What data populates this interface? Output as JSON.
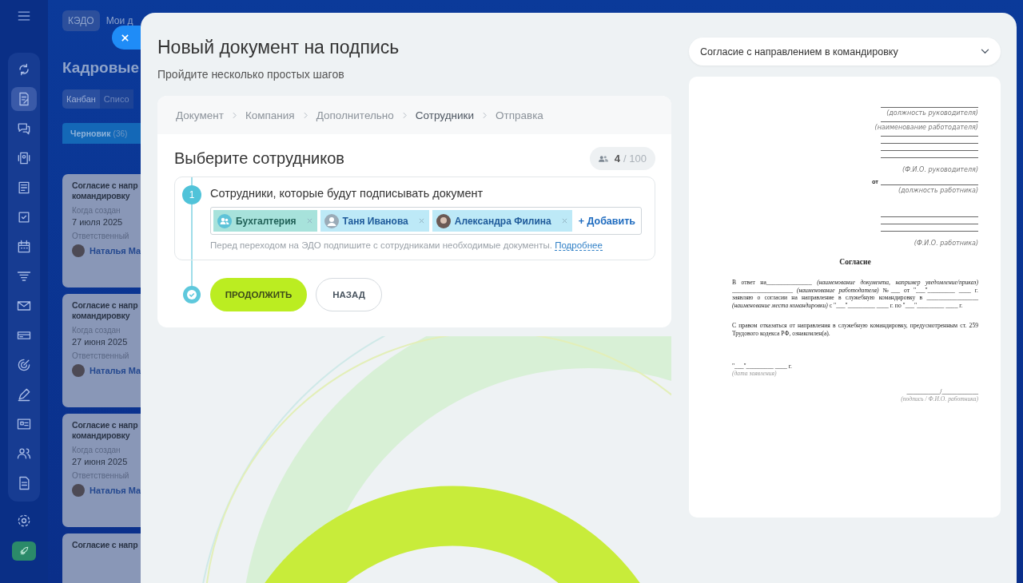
{
  "sidebar": {
    "items": [
      {
        "selected": false
      },
      {
        "selected": true
      },
      {
        "selected": false
      },
      {
        "selected": false
      },
      {
        "selected": false
      },
      {
        "selected": false
      },
      {
        "selected": false
      },
      {
        "selected": false
      },
      {
        "selected": false
      },
      {
        "selected": false
      },
      {
        "selected": false
      },
      {
        "selected": false
      },
      {
        "selected": false
      },
      {
        "selected": false
      },
      {
        "selected": false
      }
    ]
  },
  "background_page": {
    "top_tabs": [
      {
        "label": "КЭДО",
        "selected": true
      },
      {
        "label": "Мои д",
        "selected": false
      }
    ],
    "title": "Кадровые",
    "view_tabs": [
      {
        "label": "Канбан",
        "selected": true
      },
      {
        "label": "Списо",
        "selected": false
      }
    ],
    "column": {
      "name": "Черновик",
      "count": "(36)"
    },
    "cards": [
      {
        "title_lines": [
          "Согласие с напр",
          "командировку"
        ],
        "created_label": "Когда создан",
        "created": "7 июля 2025",
        "owner_label": "Ответственный",
        "owner": "Наталья Ма"
      },
      {
        "title_lines": [
          "Согласие с напр",
          "командировку"
        ],
        "created_label": "Когда создан",
        "created": "27 июня 2025",
        "owner_label": "Ответственный",
        "owner": "Наталья Ма"
      },
      {
        "title_lines": [
          "Согласие с напр",
          "командировку"
        ],
        "created_label": "Когда создан",
        "created": "27 июня 2025",
        "owner_label": "Ответственный",
        "owner": "Наталья Ма"
      },
      {
        "title_lines": [
          "Согласие с напр"
        ]
      }
    ]
  },
  "panel": {
    "title": "Новый документ на подпись",
    "subtitle": "Пройдите несколько простых шагов",
    "breadcrumbs": [
      {
        "label": "Документ",
        "selected": false
      },
      {
        "label": "Компания",
        "selected": false
      },
      {
        "label": "Дополнительно",
        "selected": false
      },
      {
        "label": "Сотрудники",
        "selected": true
      },
      {
        "label": "Отправка",
        "selected": false
      }
    ],
    "heading": "Выберите сотрудников",
    "counter": {
      "count": "4",
      "limit": "/ 100"
    },
    "step": {
      "number": "1",
      "label": "Сотрудники, которые будут подписывать документ",
      "tags": [
        {
          "label": "Бухгалтерия",
          "kind": "group"
        },
        {
          "label": "Таня Иванова",
          "kind": "user"
        },
        {
          "label": "Александра Филина",
          "kind": "photo"
        }
      ],
      "add": "+ Добавить",
      "hint": "Перед переходом на ЭДО подпишите с сотрудниками необходимые документы.",
      "hint_link": "Подробнее"
    },
    "buttons": [
      {
        "label": "ПРОДОЛЖИТЬ",
        "kind": "primary"
      },
      {
        "label": "НАЗАД",
        "kind": "secondary"
      }
    ],
    "template_select": {
      "value": "Согласие с направлением в командировку"
    },
    "document": {
      "header_fields": [
        {
          "kind": "single",
          "caption": "(должность руководителя)"
        },
        {
          "kind": "single",
          "caption": "(наименование работодателя)"
        },
        {
          "kind": "four",
          "caption": "(Ф.И.О. руководителя)"
        },
        {
          "kind": "single",
          "prefix": "от",
          "caption": "(должность работника)"
        },
        {
          "kind": "three",
          "caption": "(Ф.И.О. работника)"
        }
      ],
      "title": "Согласие",
      "paragraphs": [
        "В ответ на_______________ *(наименование документа, например уведомление/приказ)* ____________________ *(наименование работодателя)* №___ от \"___\"_________ ____ г. заявляю о согласии на направление в служебную командировку в _________________ *(наименование места командировки)* с \"___\"_________ ____ г. по \"___\"_________ ____ г.",
        "С правом отказаться от направления в служебную командировку, предусмотренным ст. 259 Трудового кодекса РФ, ознакомлен(а)."
      ],
      "date_line": "\"___\"_________ ____ г.",
      "date_caption": "(дата заявления)",
      "signature_line": "___________/____________",
      "signature_caption": "(подпись / Ф.И.О. работника)"
    }
  }
}
